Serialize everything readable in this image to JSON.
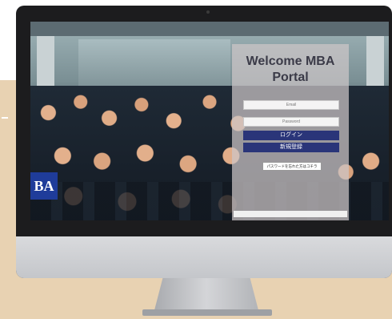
{
  "portal": {
    "title_line1": "Welcome MBA",
    "title_line2": "Portal",
    "email_placeholder": "Email",
    "password_placeholder": "Password",
    "login_label": "ログイン",
    "register_label": "新規登録",
    "forgot_label": "パスワードを忘れた方はコチラ"
  },
  "banner": {
    "sign_text": "BA"
  },
  "colors": {
    "background_beige": "#e8d2b2",
    "button_navy": "#2a3579",
    "panel_overlay": "#cdc6c8"
  }
}
